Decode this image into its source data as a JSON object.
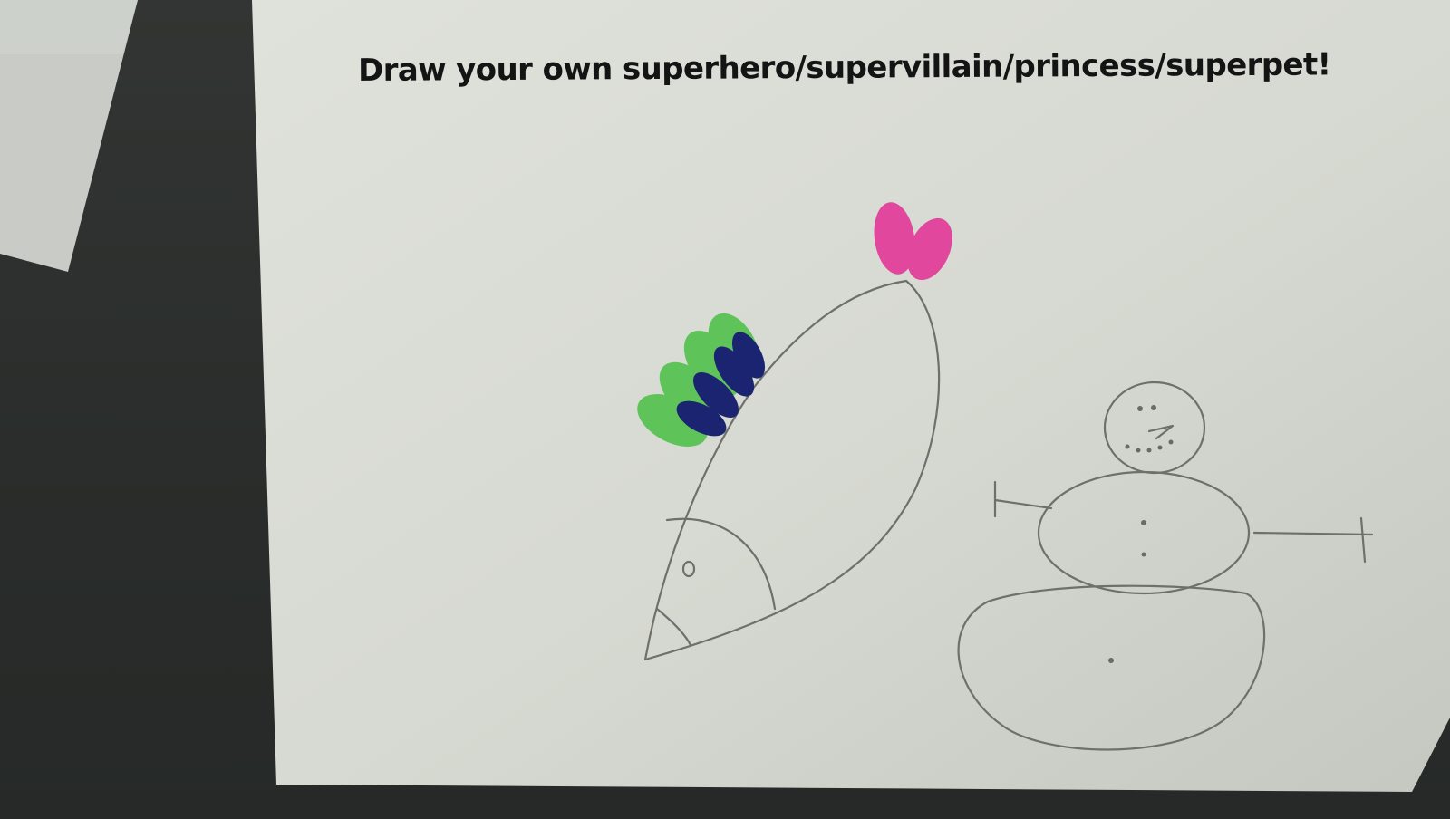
{
  "worksheet": {
    "prompt": "Draw your own superhero/supervillain/princess/superpet!"
  },
  "drawings": {
    "creature": {
      "icon": "feathered-fish-creature-icon",
      "colors": {
        "outer_scales": "#5ec45a",
        "inner_scales": "#1b2470",
        "tuft": "#e0479d"
      }
    },
    "snowman": {
      "icon": "snowman-icon"
    }
  },
  "colors": {
    "background": "#2b2e2c",
    "paper": "#d8dcd4",
    "text": "#141414",
    "pencil": "#6f6f6c"
  }
}
